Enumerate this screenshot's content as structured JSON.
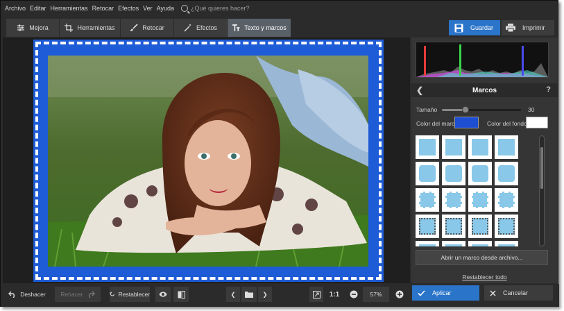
{
  "menu": [
    "Archivo",
    "Editar",
    "Herramientas",
    "Retocar",
    "Efectos",
    "Ver",
    "Ayuda"
  ],
  "search": {
    "placeholder": "¿Qué quieres hacer?"
  },
  "tabs": [
    {
      "label": "Mejora",
      "icon": "sliders-icon"
    },
    {
      "label": "Herramientas",
      "icon": "crop-icon"
    },
    {
      "label": "Retocar",
      "icon": "brush-icon"
    },
    {
      "label": "Efectos",
      "icon": "magic-wand-icon"
    },
    {
      "label": "Texto y marcos",
      "icon": "text-icon"
    }
  ],
  "toolbar": {
    "save_label": "Guardar",
    "print_label": "Imprimir"
  },
  "panel": {
    "title": "Marcos",
    "size_label": "Tamaño",
    "size_value": "30",
    "size_fraction": 0.3,
    "frame_color_label": "Color del marco:",
    "bg_color_label": "Color del fondo:",
    "frame_color": "#1e4fd2",
    "bg_color": "#ffffff",
    "open_frame_label": "Abrir un marco desde archivo...",
    "reset_all_label": "Restablecer todo"
  },
  "bottom": {
    "undo_label": "Deshacer",
    "redo_label": "Rehacer",
    "reset_label": "Restablecer",
    "ratio_label": "1:1",
    "zoom_value": "57%",
    "apply_label": "Aplicar",
    "cancel_label": "Cancelar"
  }
}
